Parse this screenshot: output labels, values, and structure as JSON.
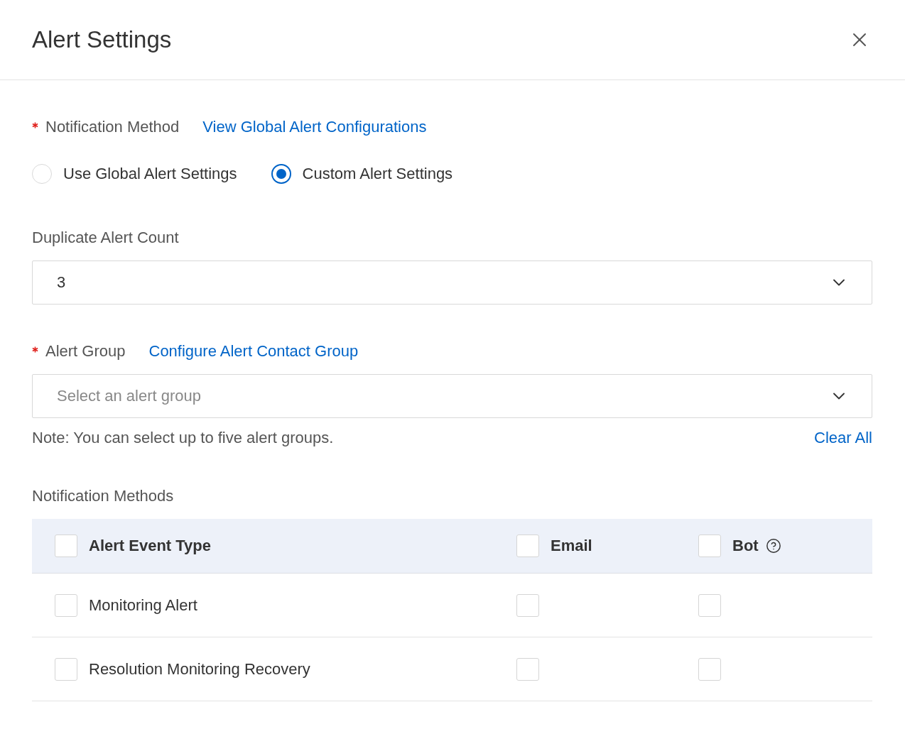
{
  "dialog": {
    "title": "Alert Settings"
  },
  "notification_method": {
    "label": "Notification Method",
    "required": true,
    "link": "View Global Alert Configurations",
    "options": [
      {
        "label": "Use Global Alert Settings",
        "selected": false
      },
      {
        "label": "Custom Alert Settings",
        "selected": true
      }
    ]
  },
  "duplicate_alert_count": {
    "label": "Duplicate Alert Count",
    "value": "3"
  },
  "alert_group": {
    "label": "Alert Group",
    "required": true,
    "link": "Configure Alert Contact Group",
    "placeholder": "Select an alert group",
    "note": "Note: You can select up to five alert groups.",
    "clear_link": "Clear All"
  },
  "notification_methods": {
    "label": "Notification Methods",
    "columns": [
      {
        "label": "Alert Event Type",
        "checked": false,
        "help": false
      },
      {
        "label": "Email",
        "checked": false,
        "help": false
      },
      {
        "label": "Bot",
        "checked": false,
        "help": true
      }
    ],
    "rows": [
      {
        "event_type": "Monitoring Alert",
        "checked": false,
        "email": false,
        "bot": false
      },
      {
        "event_type": "Resolution Monitoring Recovery",
        "checked": false,
        "email": false,
        "bot": false
      }
    ]
  }
}
